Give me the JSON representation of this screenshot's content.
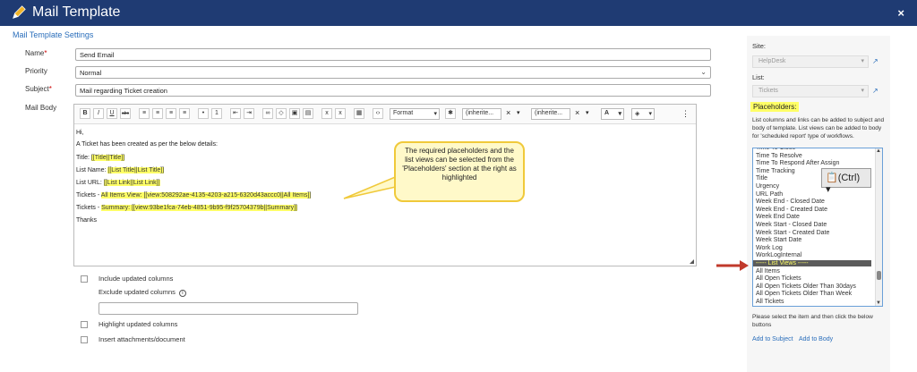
{
  "window": {
    "title": "Mail Template",
    "close_label": "×"
  },
  "section_title": "Mail Template Settings",
  "fields": {
    "name_label": "Name",
    "name_value": "Send Email",
    "priority_label": "Priority",
    "priority_value": "Normal",
    "subject_label": "Subject",
    "subject_value": "Mail regarding Ticket creation",
    "mailbody_label": "Mail Body",
    "required_mark": "*"
  },
  "toolbar": {
    "bold": "B",
    "italic": "I",
    "underline": "U",
    "strike": "abc",
    "format_label": "Format",
    "inherit1": "(inherite...",
    "inherit2": "(inherite...",
    "clear1": "×",
    "clear2": "×",
    "font_color": "A",
    "more": "⋮"
  },
  "body_lines": [
    "Hi,",
    "A Ticket has been created as per the below details:"
  ],
  "body_rows": [
    {
      "prefix": "Title: ",
      "value": "[[Title||Title]]"
    },
    {
      "prefix": "List Name: ",
      "value": "[[List Title||List Title]]"
    },
    {
      "prefix": "List URL: ",
      "value": "[[List Link||List Link]]"
    },
    {
      "prefix": "Tickets - ",
      "value": "All Items View: [[view:508292ae-4135-4203-a215-6320d43accc0||All Items]]"
    },
    {
      "prefix": "Tickets - ",
      "value": "Summary: [[view:93be1fca-74eb-4851-9b95-f9f25704379b||Summary]]"
    }
  ],
  "body_closing": "Thanks",
  "callout": "The required placeholders and the list views can be selected from the 'Placeholders' section at the right as highlighted",
  "options": {
    "include_updated": "Include updated columns",
    "exclude_updated": "Exclude updated columns",
    "info": "i",
    "highlight_updated": "Highlight updated columns",
    "insert_attachments": "Insert attachments/document"
  },
  "right_panel": {
    "site_label": "Site:",
    "site_value": "HelpDesk",
    "list_label": "List:",
    "list_value": "Tickets",
    "placeholders_label": "Placeholders:",
    "description": "List columns and links can be added to subject and body of template. List views can be added to body for 'scheduled report' type of workflows.",
    "items": [
      "Time To Close",
      "Time To Resolve",
      "Time To Respond After Assign",
      "Time Tracking",
      "Title",
      "Urgency",
      "URL Path",
      "Week End - Closed Date",
      "Week End - Created Date",
      "Week End Date",
      "Week Start - Closed Date",
      "Week Start - Created Date",
      "Week Start Date",
      "Work Log",
      "WorkLogInternal",
      "----- List Views -----",
      "All Items",
      "All Open Tickets",
      "All Open Tickets Older Than 30days",
      "All Open Tickets Older Than Week",
      "All Tickets"
    ],
    "selected_index": 15,
    "paste_tip": "(Ctrl)",
    "hint": "Please select the item and then click the below buttons",
    "add_subject": "Add to Subject",
    "add_body": "Add to Body"
  },
  "colors": {
    "titlebar": "#1f3b73",
    "highlight": "#ffff66",
    "link": "#2a6ebb",
    "arrow": "#c0392b"
  }
}
